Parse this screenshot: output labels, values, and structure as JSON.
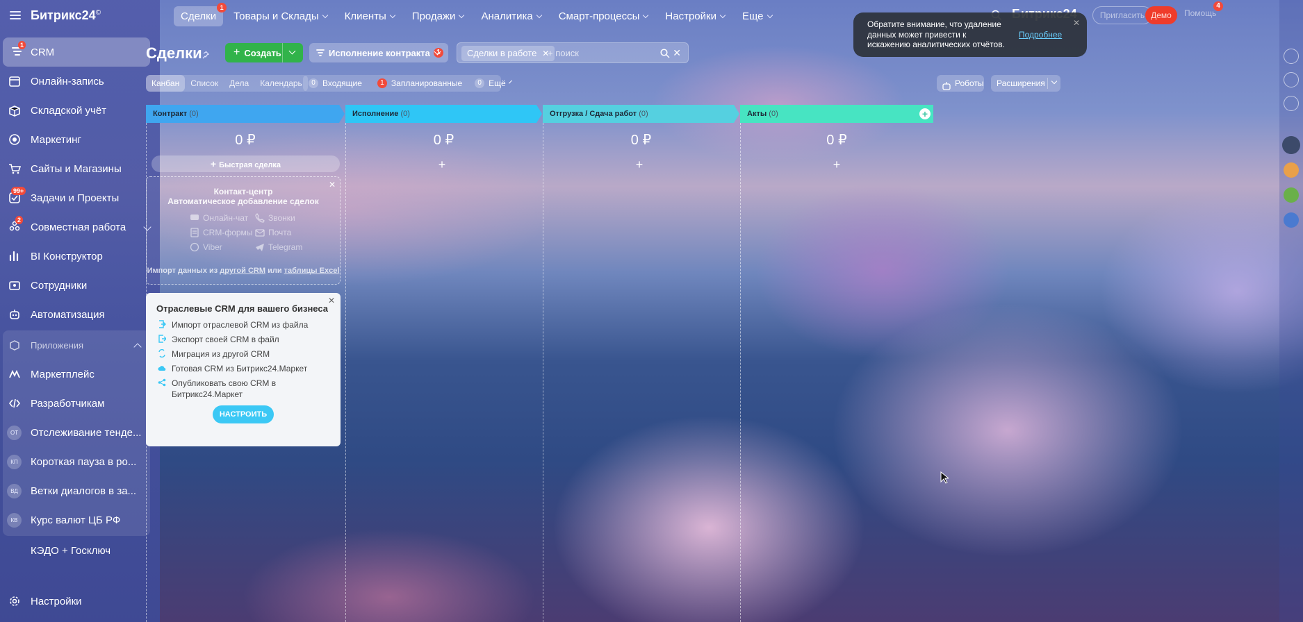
{
  "app": {
    "logo": "Битрикс24",
    "logo_mark": "©"
  },
  "sidebar": {
    "items": [
      {
        "label": "CRM",
        "icon": "funnel-icon",
        "badge": "1"
      },
      {
        "label": "Онлайн-запись",
        "icon": "calendar-icon"
      },
      {
        "label": "Складской учёт",
        "icon": "box-icon"
      },
      {
        "label": "Маркетинг",
        "icon": "megaphone-icon"
      },
      {
        "label": "Сайты и Магазины",
        "icon": "cart-icon"
      },
      {
        "label": "Задачи и Проекты",
        "icon": "checkbox-icon",
        "badge": "99+"
      },
      {
        "label": "Совместная работа",
        "icon": "people-icon",
        "badge": "2"
      },
      {
        "label": "BI Конструктор",
        "icon": "bars-icon"
      },
      {
        "label": "Сотрудники",
        "icon": "team-icon"
      },
      {
        "label": "Автоматизация",
        "icon": "robot-icon"
      }
    ],
    "apps_header": "Приложения",
    "apps": [
      {
        "label": "Маркетплейс",
        "icon": "marketplace-icon"
      },
      {
        "label": "Разработчикам",
        "icon": "code-icon"
      },
      {
        "label": "Отслеживание тенде...",
        "initials": "ОТ"
      },
      {
        "label": "Короткая пауза в ро...",
        "initials": "КП"
      },
      {
        "label": "Ветки диалогов в за...",
        "initials": "ВД"
      },
      {
        "label": "Курс валют ЦБ РФ",
        "initials": "КВ"
      }
    ],
    "kedo": "КЭДО + Госключ",
    "settings": "Настройки"
  },
  "topnav": {
    "items": [
      {
        "label": "Сделки",
        "badge": "1"
      },
      {
        "label": "Товары и Склады"
      },
      {
        "label": "Клиенты"
      },
      {
        "label": "Продажи"
      },
      {
        "label": "Аналитика"
      },
      {
        "label": "Смарт-процессы"
      },
      {
        "label": "Настройки"
      },
      {
        "label": "Еще"
      }
    ],
    "logo": "Битрикс24",
    "invite": "Пригласить",
    "demo": "Демо",
    "help": "Помощь",
    "notif_badge": "4"
  },
  "toast": {
    "text": "Обратите внимание, что удаление данных может привести к искажению аналитических отчётов.",
    "link": "Подробнее"
  },
  "page": {
    "title": "Сделки",
    "create": "Создать",
    "pipeline": "Исполнение контракта",
    "pipeline_count": "1",
    "filter_tag": "Сделки в работе",
    "filter_placeholder": "+ поиск"
  },
  "views": [
    "Канбан",
    "Список",
    "Дела",
    "Календарь"
  ],
  "counters": [
    {
      "count": "0",
      "label": "Входящие"
    },
    {
      "count": "1",
      "label": "Запланированные"
    },
    {
      "count": "0",
      "label": "Ещё"
    }
  ],
  "buttons": {
    "robots": "Роботы",
    "extensions": "Расширения"
  },
  "stages": [
    {
      "name": "Контракт",
      "count": "(0)",
      "sum": "0 ₽",
      "color": "#3fa6f0"
    },
    {
      "name": "Исполнение",
      "count": "(0)",
      "sum": "0 ₽",
      "color": "#2fc6f6"
    },
    {
      "name": "Отгрузка / Сдача работ",
      "count": "(0)",
      "sum": "0 ₽",
      "color": "#55d0e0"
    },
    {
      "name": "Акты",
      "count": "(0)",
      "sum": "0 ₽",
      "color": "#47e4c2"
    }
  ],
  "quick_deal": "Быстрая сделка",
  "contact_center": {
    "title1": "Контакт-центр",
    "title2": "Автоматическое добавление сделок",
    "sources": [
      "Онлайн-чат",
      "Звонки",
      "CRM-формы",
      "Почта",
      "Viber",
      "Telegram"
    ],
    "import_prefix": "Импорт данных из",
    "import_link1": "другой CRM",
    "import_or": "или",
    "import_link2": "таблицы Excel"
  },
  "industry": {
    "title": "Отраслевые CRM для вашего бизнеса",
    "items": [
      "Импорт отраслевой CRM из файла",
      "Экспорт своей CRM в файл",
      "Миграция из другой CRM",
      "Готовая CRM из Битрикс24.Маркет",
      "Опубликовать свою CRM в Битрикс24.Маркет"
    ],
    "button": "НАСТРОИТЬ"
  }
}
